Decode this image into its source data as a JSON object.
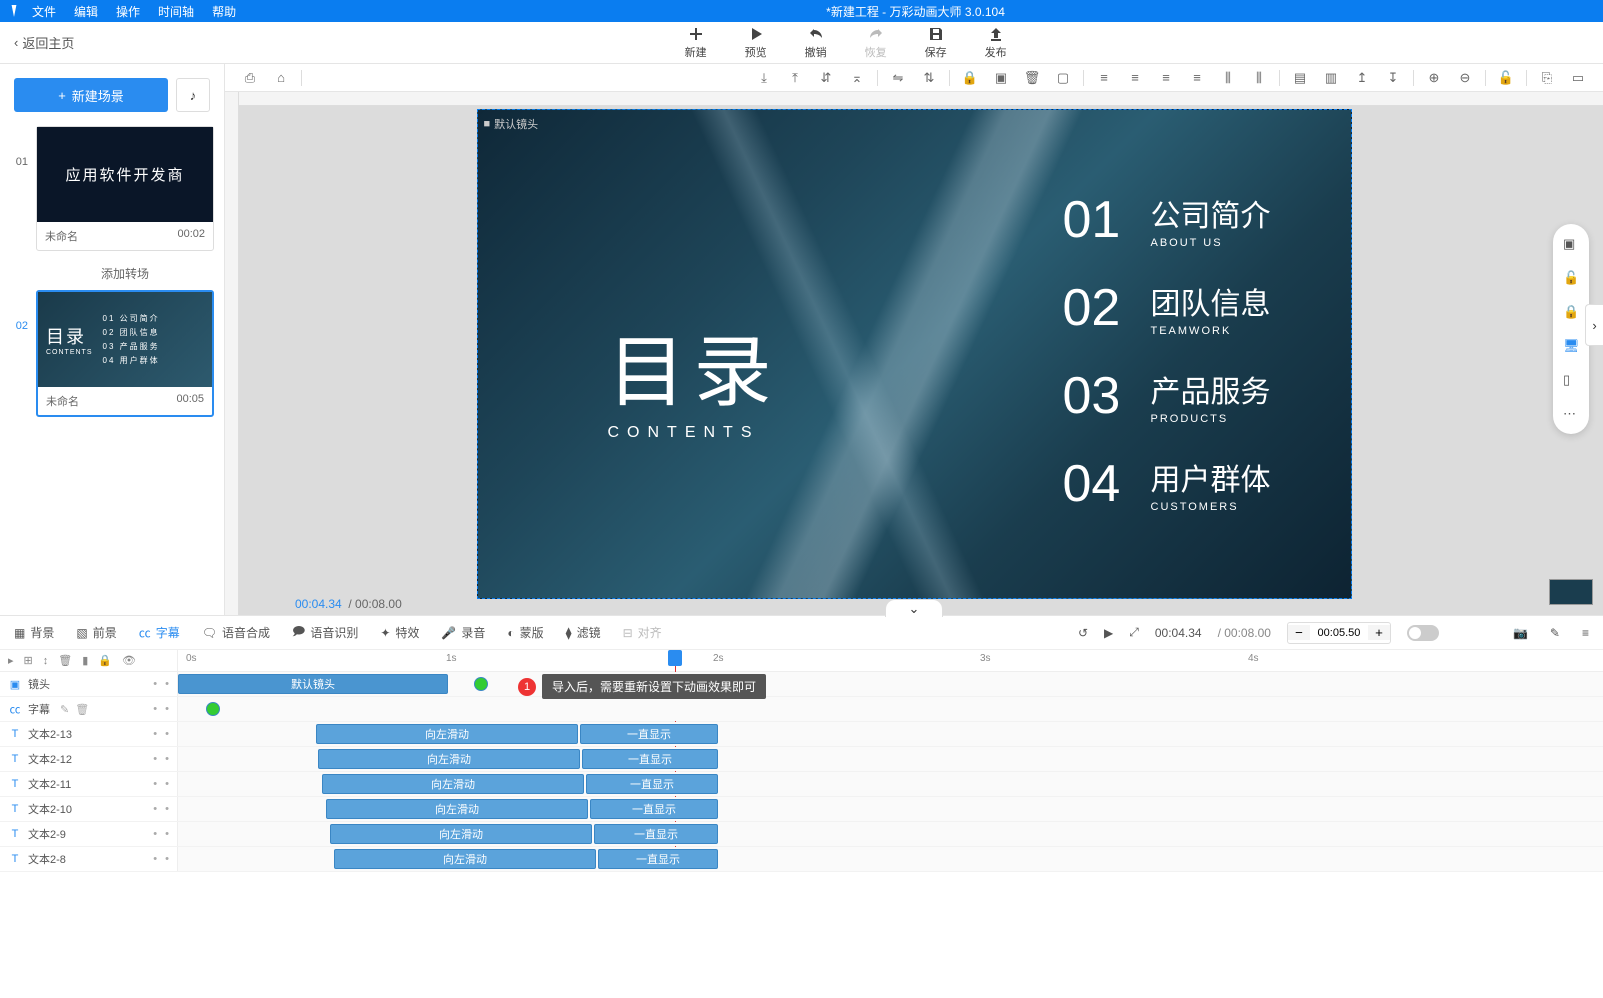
{
  "titlebar": {
    "menus": [
      "文件",
      "编辑",
      "操作",
      "时间轴",
      "帮助"
    ],
    "title": "*新建工程 - 万彩动画大师 3.0.104"
  },
  "topbar": {
    "back": "返回主页",
    "tools": [
      {
        "label": "新建",
        "icon": "plus"
      },
      {
        "label": "预览",
        "icon": "play"
      },
      {
        "label": "撤销",
        "icon": "undo"
      },
      {
        "label": "恢复",
        "icon": "redo",
        "disabled": true
      },
      {
        "label": "保存",
        "icon": "save"
      },
      {
        "label": "发布",
        "icon": "publish"
      }
    ]
  },
  "sidebar": {
    "new_scene": "新建场景",
    "scenes": [
      {
        "idx": "01",
        "name": "未命名",
        "dur": "00:02",
        "thumb_text": "应用软件开发商"
      },
      {
        "idx": "02",
        "name": "未命名",
        "dur": "00:05",
        "thumb_mulu": "目录",
        "thumb_sub": "CONTENTS"
      }
    ],
    "add_transition": "添加转场"
  },
  "stage": {
    "camera_label": "默认镜头",
    "left_big": "目录",
    "left_sub": "CONTENTS",
    "items": [
      {
        "num": "01",
        "cn": "公司简介",
        "en": "ABOUT US"
      },
      {
        "num": "02",
        "cn": "团队信息",
        "en": "TEAMWORK"
      },
      {
        "num": "03",
        "cn": "产品服务",
        "en": "PRODUCTS"
      },
      {
        "num": "04",
        "cn": "用户群体",
        "en": "CUSTOMERS"
      }
    ]
  },
  "time_info": {
    "current": "00:04.34",
    "total": "/ 00:08.00"
  },
  "tabs": {
    "items": [
      {
        "label": "背景",
        "active": false
      },
      {
        "label": "前景",
        "active": false
      },
      {
        "label": "字幕",
        "active": true
      },
      {
        "label": "语音合成",
        "active": false
      },
      {
        "label": "语音识别",
        "active": false
      },
      {
        "label": "特效",
        "active": false
      },
      {
        "label": "录音",
        "active": false
      },
      {
        "label": "蒙版",
        "active": false
      },
      {
        "label": "滤镜",
        "active": false
      },
      {
        "label": "对齐",
        "active": false
      }
    ],
    "play_current": "00:04.34",
    "play_total": "/ 00:08.00",
    "zoom_value": "00:05.50"
  },
  "timeline": {
    "ticks": [
      "0s",
      "1s",
      "2s",
      "3s",
      "4s"
    ],
    "rows": [
      {
        "type": "camera",
        "label": "镜头",
        "clip_label": "默认镜头"
      },
      {
        "type": "subtitle",
        "label": "字幕"
      },
      {
        "type": "text",
        "label": "文本2-13",
        "anim": "向左滑动",
        "stay": "一直显示"
      },
      {
        "type": "text",
        "label": "文本2-12",
        "anim": "向左滑动",
        "stay": "一直显示"
      },
      {
        "type": "text",
        "label": "文本2-11",
        "anim": "向左滑动",
        "stay": "一直显示"
      },
      {
        "type": "text",
        "label": "文本2-10",
        "anim": "向左滑动",
        "stay": "一直显示"
      },
      {
        "type": "text",
        "label": "文本2-9",
        "anim": "向左滑动",
        "stay": "一直显示"
      },
      {
        "type": "text",
        "label": "文本2-8",
        "anim": "向左滑动",
        "stay": "一直显示"
      }
    ]
  },
  "tooltip": {
    "num": "1",
    "text": "导入后，需要重新设置下动画效果即可"
  }
}
